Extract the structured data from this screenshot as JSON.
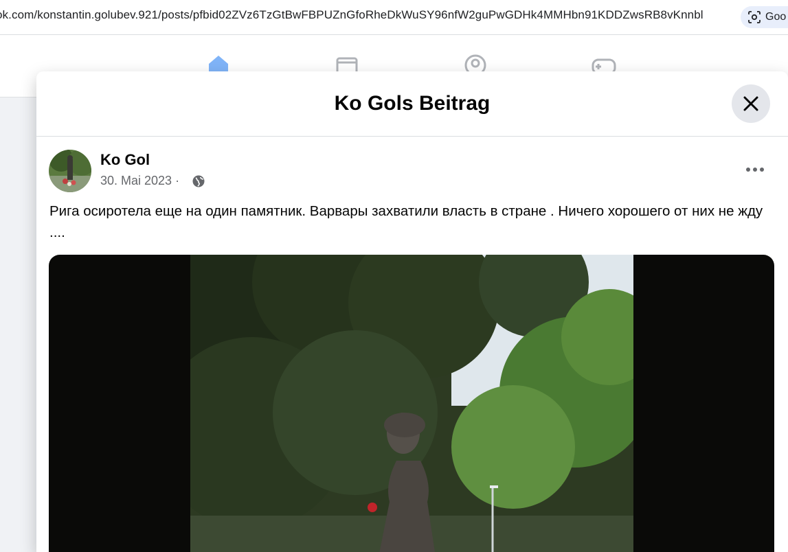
{
  "browser": {
    "url": "ok.com/konstantin.golubev.921/posts/pfbid02ZVz6TzGtBwFBPUZnGfoRheDkWuSY96nfW2guPwGDHk4MMHbn91KDDZwsRB8vKnnbl",
    "lens_label": "Goo"
  },
  "nav": {
    "icons": [
      "home-icon",
      "marketplace-icon",
      "groups-icon",
      "gaming-icon"
    ],
    "accent_color": "#1877f2"
  },
  "modal": {
    "title": "Ko Gols Beitrag",
    "close_icon": "close-icon"
  },
  "post": {
    "author": "Ko Gol",
    "date": "30. Mai 2023",
    "separator": "·",
    "audience_icon": "globe-icon",
    "more_icon": "more-horizontal-icon",
    "text": "Рига осиротела еще на один памятник. Варвары захватили  власть в стране . Ничего хорошего от них не жду ...."
  }
}
